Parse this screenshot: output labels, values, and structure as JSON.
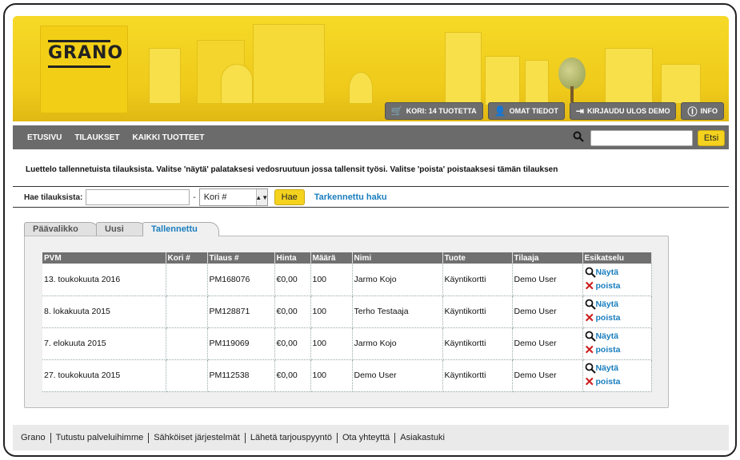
{
  "brand": {
    "logo_text": "GRANO",
    "accent": "#f4d21e",
    "link_color": "#1a7ebe"
  },
  "header_buttons": [
    {
      "icon": "cart-icon",
      "label": "KORI: 14 TUOTETTA"
    },
    {
      "icon": "user-icon",
      "label": "OMAT TIEDOT"
    },
    {
      "icon": "logout-icon",
      "label": "KIRJAUDU ULOS DEMO"
    },
    {
      "icon": "info-icon",
      "label": "INFO"
    }
  ],
  "nav": {
    "items": [
      "ETUSIVU",
      "TILAUKSET",
      "KAIKKI TUOTTEET"
    ],
    "search_button": "Etsi",
    "search_value": ""
  },
  "intro_text": "Luettelo tallennetuista tilauksista. Valitse 'näytä' palataksesi vedosruutuun jossa tallensit työsi. Valitse 'poista' poistaaksesi tämän tilauksen",
  "search": {
    "label": "Hae tilauksista:",
    "order_value": "",
    "dash": "-",
    "kori_selected": "Kori #",
    "button": "Hae",
    "advanced_link": "Tarkennettu haku"
  },
  "tabs": [
    "Päävalikko",
    "Uusi",
    "Tallennettu"
  ],
  "active_tab": "Tallennettu",
  "table": {
    "headers": [
      "PVM",
      "Kori #",
      "Tilaus #",
      "Hinta",
      "Määrä",
      "Nimi",
      "Tuote",
      "Tilaaja",
      "Esikatselu"
    ],
    "show_label": "Näytä",
    "delete_label": "poista",
    "rows": [
      {
        "pvm": "13. toukokuuta 2016",
        "kori": "",
        "tilaus": "PM168076",
        "hinta": "€0,00",
        "maara": "100",
        "nimi": "Jarmo Kojo",
        "tuote": "Käyntikortti",
        "tilaaja": "Demo User"
      },
      {
        "pvm": "8. lokakuuta 2015",
        "kori": "",
        "tilaus": "PM128871",
        "hinta": "€0,00",
        "maara": "100",
        "nimi": "Terho Testaaja",
        "tuote": "Käyntikortti",
        "tilaaja": "Demo User"
      },
      {
        "pvm": "7. elokuuta 2015",
        "kori": "",
        "tilaus": "PM119069",
        "hinta": "€0,00",
        "maara": "100",
        "nimi": "Jarmo Kojo",
        "tuote": "Käyntikortti",
        "tilaaja": "Demo User"
      },
      {
        "pvm": "27. toukokuuta 2015",
        "kori": "",
        "tilaus": "PM112538",
        "hinta": "€0,00",
        "maara": "100",
        "nimi": "Demo User",
        "tuote": "Käyntikortti",
        "tilaaja": "Demo User"
      }
    ]
  },
  "footer": [
    "Grano",
    "Tutustu palveluihimme",
    "Sähköiset järjestelmät",
    "Lähetä tarjouspyyntö",
    "Ota yhteyttä",
    "Asiakastuki"
  ]
}
